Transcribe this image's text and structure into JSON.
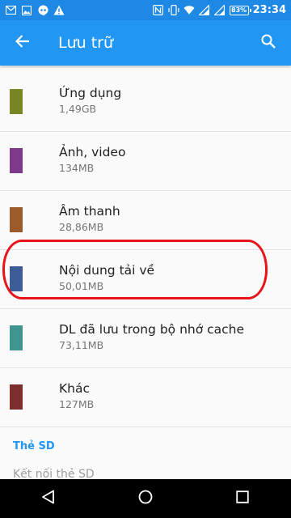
{
  "status_bar": {
    "time": "23:34",
    "battery": "83%"
  },
  "app_bar": {
    "title": "Lưu trữ",
    "back_icon": "arrow-back-icon",
    "search_icon": "search-icon",
    "color": "#2196f3"
  },
  "items": [
    {
      "title": "Ứng dụng",
      "size": "1,49GB",
      "color": "#7a8623"
    },
    {
      "title": "Ảnh, video",
      "size": "134MB",
      "color": "#7d3a8a"
    },
    {
      "title": "Âm thanh",
      "size": "28,86MB",
      "color": "#9b5a2a"
    },
    {
      "title": "Nội dung tải về",
      "size": "50,01MB",
      "color": "#3e5c98"
    },
    {
      "title": "DL đã lưu trong bộ nhớ cache",
      "size": "73,11MB",
      "color": "#3f9490"
    },
    {
      "title": "Khác",
      "size": "127MB",
      "color": "#7e2d2f"
    }
  ],
  "section": {
    "header": "Thẻ SD",
    "link": "Kết nối thẻ SD"
  },
  "nav_bar": {
    "back_icon": "nav-back-icon",
    "home_icon": "nav-home-icon",
    "recents_icon": "nav-recents-icon"
  }
}
